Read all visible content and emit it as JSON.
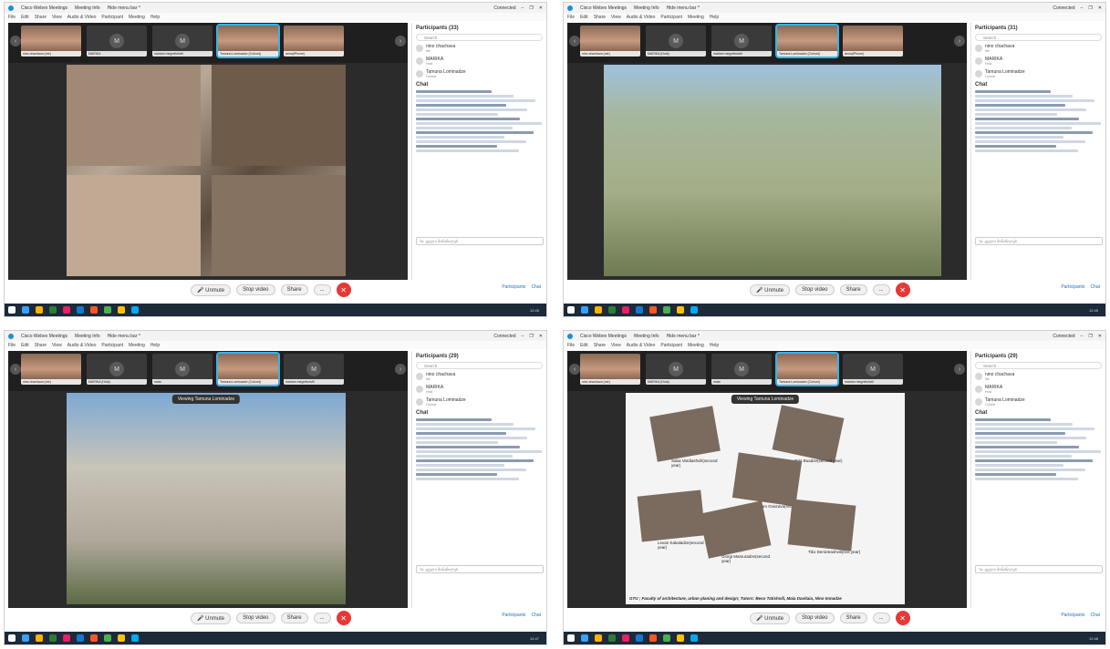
{
  "window": {
    "app_title": "Cisco Webex Meetings",
    "meeting_info": "Meeting Info",
    "hide_menu": "Hide menu bar ^",
    "status": "Connected",
    "menu": [
      "File",
      "Edit",
      "Share",
      "View",
      "Audio & Video",
      "Participant",
      "Meeting",
      "Help"
    ]
  },
  "controls": {
    "unmute": "Unmute",
    "stop_video": "Stop video",
    "share": "Share",
    "more": "...",
    "participants": "Participants",
    "chat": "Chat"
  },
  "panel": {
    "search_placeholder": "Search",
    "participant_rows": [
      {
        "name": "nino chachava",
        "role": "Me"
      },
      {
        "name": "MARIKA",
        "role": "Host"
      },
      {
        "name": "Tamuna Lominadze",
        "role": "Cohost"
      }
    ],
    "chat_title": "Chat",
    "to_label": "To:",
    "to_value": "ყველა მონაწილეს"
  },
  "screens": [
    {
      "participants_count": "Participants (33)",
      "thumbs": [
        {
          "label": "nino chachava (me)",
          "kind": "photo"
        },
        {
          "label": "MARIKA",
          "kind": "m",
          "initial": "M"
        },
        {
          "label": "mariam megrelishvili",
          "kind": "m",
          "initial": "M"
        },
        {
          "label": "Tamuna Lominadze (Cohost)",
          "kind": "photo",
          "active": true
        },
        {
          "label": "anna(iPhone)",
          "kind": "photo"
        }
      ],
      "viewing": "",
      "time": "12:45"
    },
    {
      "participants_count": "Participants (31)",
      "thumbs": [
        {
          "label": "nino chachava (me)",
          "kind": "photo"
        },
        {
          "label": "MARIKA (Host)",
          "kind": "m",
          "initial": "M"
        },
        {
          "label": "mariam megrelishvili",
          "kind": "m",
          "initial": "M"
        },
        {
          "label": "Tamuna Lominadze (Cohost)",
          "kind": "photo",
          "active": true
        },
        {
          "label": "anna(iPhone)",
          "kind": "photo"
        }
      ],
      "viewing": "",
      "time": "12:45"
    },
    {
      "participants_count": "Participants (29)",
      "thumbs": [
        {
          "label": "nino chachava (me)",
          "kind": "photo"
        },
        {
          "label": "MARIKA (Host)",
          "kind": "m",
          "initial": "M"
        },
        {
          "label": "maia",
          "kind": "m",
          "initial": "M"
        },
        {
          "label": "Tamuna Lominadze (Cohost)",
          "kind": "photo",
          "active": true
        },
        {
          "label": "mariam megrelishvili",
          "kind": "m",
          "initial": "M"
        }
      ],
      "viewing": "Viewing Tamuna Lominadze",
      "time": "12:47"
    },
    {
      "participants_count": "Participants (29)",
      "thumbs": [
        {
          "label": "nino chachava (me)",
          "kind": "photo"
        },
        {
          "label": "MARIKA (Host)",
          "kind": "m",
          "initial": "M"
        },
        {
          "label": "maia",
          "kind": "m",
          "initial": "M"
        },
        {
          "label": "Tamuna Lominadze (Cohost)",
          "kind": "photo",
          "active": true
        },
        {
          "label": "mariam megrelishvili",
          "kind": "m",
          "initial": "M"
        }
      ],
      "viewing": "Viewing Tamuna Lominadze",
      "time": "12:48"
    }
  ],
  "collage": {
    "people": [
      {
        "name": "Saba Vardiashvili(second year)"
      },
      {
        "name": "Tata Buadze(second year)"
      },
      {
        "name": "Mariam Gvazava(first year)"
      },
      {
        "name": "Levan Kakaladze(second year)"
      },
      {
        "name": "Giorgi Mamuradze(second year)"
      },
      {
        "name": "Tiko Demetrashvili(first year)"
      }
    ],
    "caption": "GTU ; Faculty of architecture, urban planing and design; Tutors: Beso Tatishvili, Maia Davitaia, Nino Imnadze"
  },
  "colors": {
    "accent": "#35b5e8",
    "end": "#e53935",
    "taskbar": "#1c2a3a",
    "link": "#1a73c8"
  }
}
